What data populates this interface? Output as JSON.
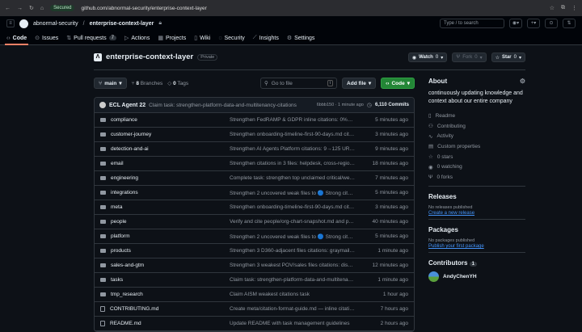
{
  "browser": {
    "secured": "Secured",
    "url": "github.com/abnormal-security/enterprise-context-layer"
  },
  "header": {
    "owner": "abnormal-security",
    "sep": "/",
    "repo": "enterprise-context-layer",
    "search": "Type / to search"
  },
  "tabs": [
    {
      "label": "Code"
    },
    {
      "label": "Issues"
    },
    {
      "label": "Pull requests",
      "count": "7"
    },
    {
      "label": "Actions"
    },
    {
      "label": "Projects"
    },
    {
      "label": "Wiki"
    },
    {
      "label": "Security"
    },
    {
      "label": "Insights"
    },
    {
      "label": "Settings"
    }
  ],
  "repo": {
    "name": "enterprise-context-layer",
    "visibility": "Private",
    "watch": "Watch",
    "watch_count": "0",
    "fork": "Fork",
    "fork_count": "0",
    "star": "Star",
    "star_count": "0"
  },
  "branch": {
    "name": "main",
    "branches": "8",
    "branches_label": "Branches",
    "tags": "0",
    "tags_label": "Tags",
    "goto": "Go to file",
    "goto_key": "t",
    "add_file": "Add file",
    "code": "Code"
  },
  "commit": {
    "author": "ECL Agent 22",
    "message": "Claim task: strengthen-platform-data-and-multitenancy-citations",
    "sha_time": "6bbb150 · 1 minute ago",
    "commits": "6,110 Commits"
  },
  "files": [
    {
      "name": "compliance",
      "type": "dir",
      "msg": "Strengthen FedRAMP & GDPR inline citations: 0%→72.6% ...",
      "time": "5 minutes ago"
    },
    {
      "name": "customer-journey",
      "type": "dir",
      "msg": "Strengthen onboarding-timeline-first-90-days.md citation...",
      "time": "3 minutes ago"
    },
    {
      "name": "detection-and-ai",
      "type": "dir",
      "msg": "Strengthen AI Agents Platform citations: 9→125 URLs, den...",
      "time": "9 minutes ago"
    },
    {
      "name": "email",
      "type": "dir",
      "msg": "Strengthen citations in 3 files: helpdesk, cross-region, thr...",
      "time": "18 minutes ago"
    },
    {
      "name": "engineering",
      "type": "dir",
      "msg": "Complete task: strengthen top unclaimed critical/weak ove...",
      "time": "7 minutes ago"
    },
    {
      "name": "integrations",
      "type": "dir",
      "msg": "Strengthen 2 uncovered weak files to 🔵 Strong citation d...",
      "time": "5 minutes ago"
    },
    {
      "name": "meta",
      "type": "dir",
      "msg": "Strengthen onboarding-timeline-first-90-days.md citation...",
      "time": "3 minutes ago"
    },
    {
      "name": "people",
      "type": "dir",
      "msg": "Verify and cite people/org-chart-snapshot.md and people/...",
      "time": "40 minutes ago"
    },
    {
      "name": "platform",
      "type": "dir",
      "msg": "Strengthen 2 uncovered weak files to 🔵 Strong citation d...",
      "time": "5 minutes ago"
    },
    {
      "name": "products",
      "type": "dir",
      "msg": "Strengthen 3 D360-adjacent files citations: graymail-fp-s...",
      "time": "1 minute ago"
    },
    {
      "name": "sales-and-gtm",
      "type": "dir",
      "msg": "Strengthen 3 weakest POV/sales files citations: displacem...",
      "time": "12 minutes ago"
    },
    {
      "name": "tasks",
      "type": "dir",
      "msg": "Claim task: strengthen-platform-data-and-multitenancy-c...",
      "time": "1 minute ago"
    },
    {
      "name": "tmp_research",
      "type": "dir",
      "msg": "Claim AISM weakest citations task",
      "time": "1 hour ago"
    },
    {
      "name": "CONTRIBUTING.md",
      "type": "file",
      "msg": "Create meta/citation-format-guide.md — inline citation for...",
      "time": "7 hours ago"
    },
    {
      "name": "README.md",
      "type": "file",
      "msg": "Update README with task management guidelines",
      "time": "2 hours ago"
    }
  ],
  "about": {
    "title": "About",
    "description": "continuously updating knowledge and context about our entire company",
    "items": [
      "Readme",
      "Contributing",
      "Activity",
      "Custom properties",
      "0 stars",
      "0 watching",
      "0 forks"
    ]
  },
  "releases": {
    "title": "Releases",
    "empty": "No releases published",
    "link": "Create a new release"
  },
  "packages": {
    "title": "Packages",
    "empty": "No packages published",
    "link": "Publish your first package"
  },
  "contributors": {
    "title": "Contributors",
    "count": "1",
    "users": [
      "AndyChenYH"
    ]
  }
}
